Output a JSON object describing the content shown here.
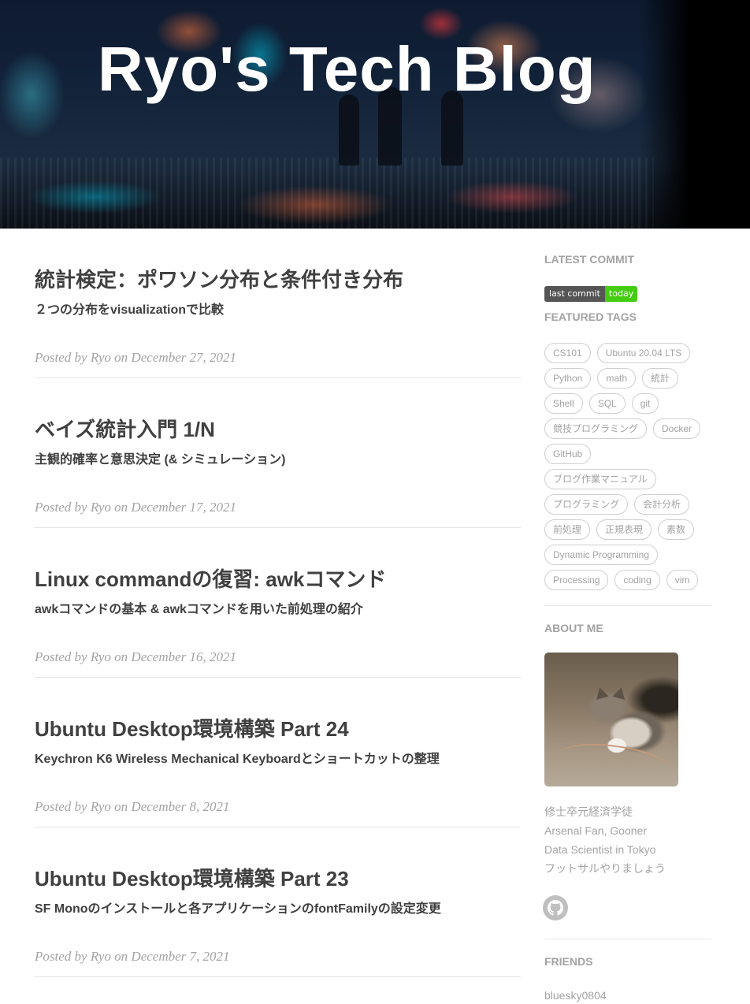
{
  "header": {
    "title": "Ryo's Tech Blog"
  },
  "posts": [
    {
      "title": "統計検定：ポワソン分布と条件付き分布",
      "subtitle": "２つの分布をvisualizationで比較",
      "meta": "Posted by Ryo on December 27, 2021"
    },
    {
      "title": "ベイズ統計入門 1/N",
      "subtitle": "主観的確率と意思決定 (& シミュレーション)",
      "meta": "Posted by Ryo on December 17, 2021"
    },
    {
      "title": "Linux commandの復習: awkコマンド",
      "subtitle": "awkコマンドの基本 & awkコマンドを用いた前処理の紹介",
      "meta": "Posted by Ryo on December 16, 2021"
    },
    {
      "title": "Ubuntu Desktop環境構築 Part 24",
      "subtitle": "Keychron K6 Wireless Mechanical Keyboardとショートカットの整理",
      "meta": "Posted by Ryo on December 8, 2021"
    },
    {
      "title": "Ubuntu Desktop環境構築 Part 23",
      "subtitle": "SF Monoのインストールと各アプリケーションのfontFamilyの設定変更",
      "meta": "Posted by Ryo on December 7, 2021"
    }
  ],
  "sidebar": {
    "latest_commit_heading": "LATEST COMMIT",
    "badge": {
      "label": "last commit",
      "value": "today",
      "value_color": "#44cc11"
    },
    "featured_tags_heading": "FEATURED TAGS",
    "tag_rows": [
      [
        "CS101",
        "Ubuntu 20.04 LTS"
      ],
      [
        "Python",
        "math",
        "統計"
      ],
      [
        "Shell",
        "SQL",
        "git"
      ],
      [
        "競技プログラミング",
        "Docker"
      ],
      [
        "GitHub"
      ],
      [
        "ブログ作業マニュアル"
      ],
      [
        "プログラミング",
        "会計分析"
      ],
      [
        "前処理",
        "正規表現",
        "素数"
      ],
      [
        "Dynamic Programming"
      ],
      [
        "Processing",
        "coding",
        "vim"
      ]
    ],
    "about_heading": "ABOUT ME",
    "about_lines": [
      "修士卒元経済学徒",
      "Arsenal Fan, Gooner",
      "Data Scientist in Tokyo",
      "フットサルやりましょう"
    ],
    "social_icon": "github-icon",
    "friends_heading": "FRIENDS",
    "friends": [
      "bluesky0804"
    ]
  }
}
